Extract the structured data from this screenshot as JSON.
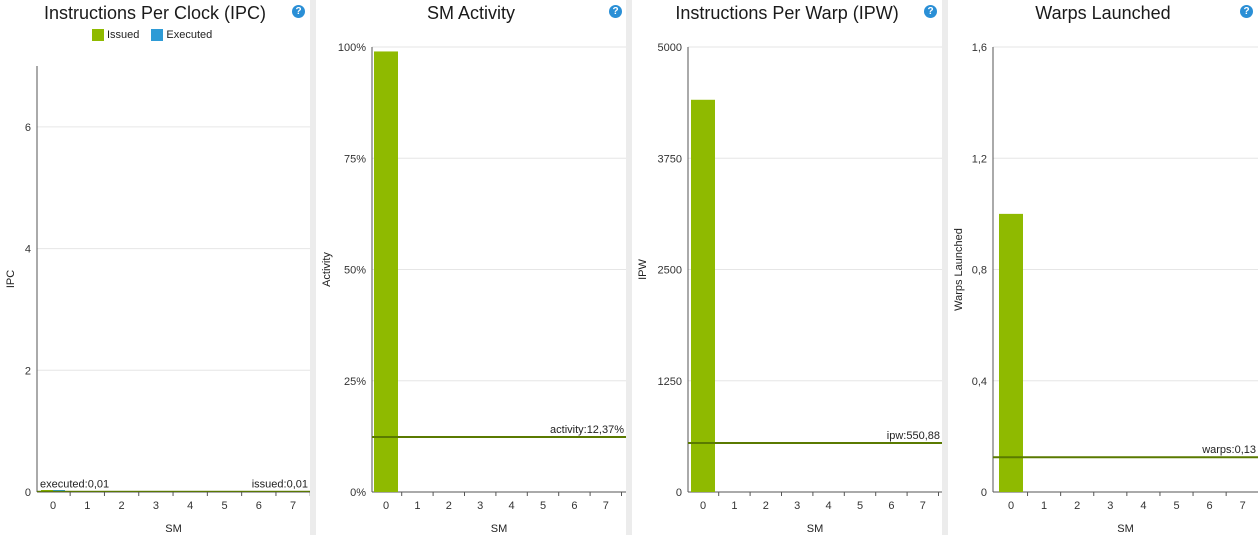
{
  "colors": {
    "issued": "#8fba00",
    "executed": "#2e9bd6",
    "avg_line": "#5a7a00",
    "grid": "#e6e6e6",
    "axis": "#555555",
    "help": "#2a8fd6"
  },
  "help_icon": {
    "name": "help-icon",
    "glyph": "?"
  },
  "chart_data": [
    {
      "type": "bar",
      "title": "Instructions Per Clock (IPC)",
      "xlabel": "SM",
      "ylabel": "IPC",
      "categories": [
        "0",
        "1",
        "2",
        "3",
        "4",
        "5",
        "6",
        "7"
      ],
      "ylim": [
        0,
        7
      ],
      "yticks": [
        "0",
        "2",
        "4",
        "6"
      ],
      "ytick_values": [
        0,
        2,
        4,
        6
      ],
      "grid": true,
      "legend": "top-center",
      "series": [
        {
          "name": "Issued",
          "values": [
            0.01,
            0,
            0,
            0,
            0,
            0,
            0,
            0
          ]
        },
        {
          "name": "Executed",
          "values": [
            0.01,
            0,
            0,
            0,
            0,
            0,
            0,
            0
          ]
        }
      ],
      "reference_lines": [
        {
          "label": "executed:0,01",
          "value": 0.01,
          "position": "left"
        },
        {
          "label": "issued:0,01",
          "value": 0.01,
          "position": "right"
        }
      ]
    },
    {
      "type": "bar",
      "title": "SM Activity",
      "xlabel": "SM",
      "ylabel": "Activity",
      "categories": [
        "0",
        "1",
        "2",
        "3",
        "4",
        "5",
        "6",
        "7"
      ],
      "ylim": [
        0,
        100
      ],
      "yticks": [
        "0%",
        "25%",
        "50%",
        "75%",
        "100%"
      ],
      "ytick_values": [
        0,
        25,
        50,
        75,
        100
      ],
      "grid": true,
      "series": [
        {
          "values": [
            99,
            0,
            0,
            0,
            0,
            0,
            0,
            0
          ]
        }
      ],
      "reference_lines": [
        {
          "label": "activity:12,37%",
          "value": 12.37,
          "position": "right"
        }
      ]
    },
    {
      "type": "bar",
      "title": "Instructions Per Warp (IPW)",
      "xlabel": "SM",
      "ylabel": "IPW",
      "categories": [
        "0",
        "1",
        "2",
        "3",
        "4",
        "5",
        "6",
        "7"
      ],
      "ylim": [
        0,
        5000
      ],
      "yticks": [
        "0",
        "1250",
        "2500",
        "3750",
        "5000"
      ],
      "ytick_values": [
        0,
        1250,
        2500,
        3750,
        5000
      ],
      "grid": true,
      "series": [
        {
          "values": [
            4407,
            0,
            0,
            0,
            0,
            0,
            0,
            0
          ]
        }
      ],
      "reference_lines": [
        {
          "label": "ipw:550,88",
          "value": 550.88,
          "position": "right"
        }
      ]
    },
    {
      "type": "bar",
      "title": "Warps Launched",
      "xlabel": "SM",
      "ylabel": "Warps Launched",
      "categories": [
        "0",
        "1",
        "2",
        "3",
        "4",
        "5",
        "6",
        "7"
      ],
      "ylim": [
        0,
        1.6
      ],
      "yticks": [
        "0",
        "0,4",
        "0,8",
        "1,2",
        "1,6"
      ],
      "ytick_values": [
        0,
        0.4,
        0.8,
        1.2,
        1.6
      ],
      "grid": true,
      "series": [
        {
          "values": [
            1,
            0,
            0,
            0,
            0,
            0,
            0,
            0
          ]
        }
      ],
      "reference_lines": [
        {
          "label": "warps:0,13",
          "value": 0.125,
          "position": "right"
        }
      ]
    }
  ]
}
